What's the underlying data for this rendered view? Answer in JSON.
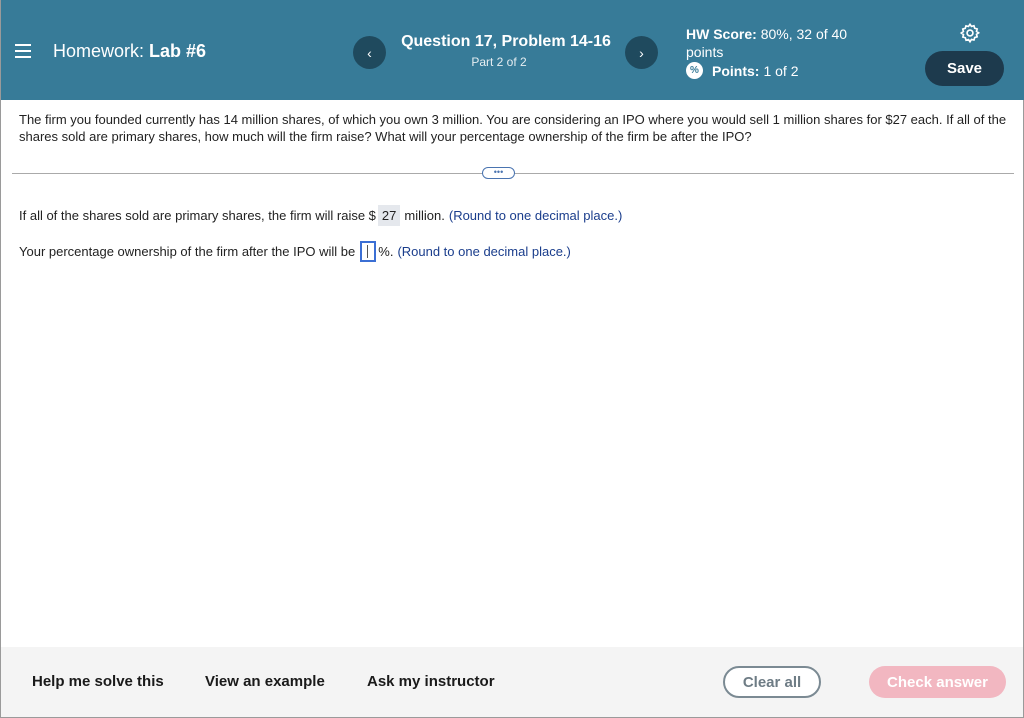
{
  "header": {
    "homework_prefix": "Homework:",
    "homework_name": "Lab #6",
    "question_title": "Question 17, Problem 14-16",
    "question_part": "Part 2 of 2",
    "prev_glyph": "‹",
    "next_glyph": "›",
    "hw_score_label": "HW Score:",
    "hw_score_value": "80%, 32 of 40",
    "hw_score_unit": "points",
    "points_label": "Points:",
    "points_value": "1 of 2",
    "save_label": "Save",
    "accent_color": "#377b98"
  },
  "question": {
    "text": "The firm you founded currently has 14 million shares, of which you own 3 million. You are considering an IPO where you would sell 1 million shares for $27 each. If all of the shares sold are primary shares, how much will the firm raise? What will your percentage ownership of the firm be after the IPO?"
  },
  "expand_glyph": "•••",
  "answers": {
    "a1_prefix": "If all of the shares sold are primary shares, the firm will raise $",
    "a1_value": "27",
    "a1_suffix": "million.",
    "a1_hint": "(Round to one decimal place.)",
    "a2_prefix": "Your percentage ownership of the firm after the IPO will be",
    "a2_value": "",
    "a2_suffix": "%.",
    "a2_hint": "(Round to one decimal place.)"
  },
  "footer": {
    "help_label": "Help me solve this",
    "example_label": "View an example",
    "instructor_label": "Ask my instructor",
    "clear_label": "Clear all",
    "check_label": "Check answer"
  }
}
